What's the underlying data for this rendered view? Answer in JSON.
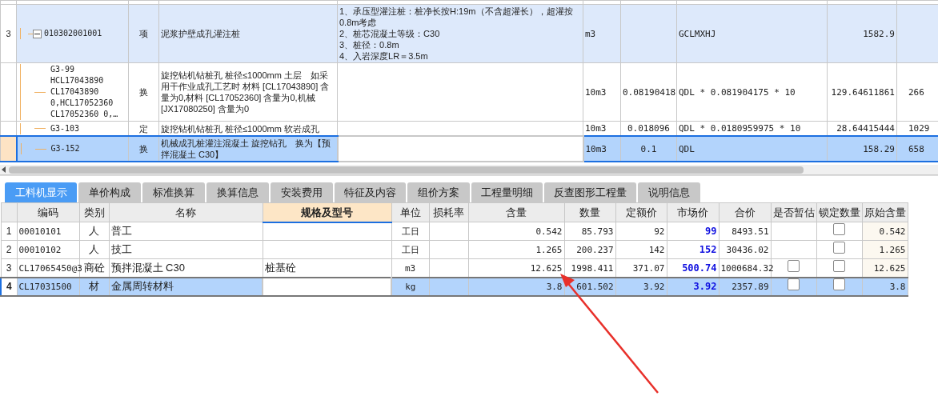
{
  "top_table": {
    "rows": [
      {
        "row_number": "3",
        "kind": "item",
        "expanded": true,
        "selected": false,
        "code": "010302001001",
        "type": "项",
        "name": "泥浆护壁成孔灌注桩",
        "features": [
          "1、承压型灌注桩：桩净长按H:19m（不含超灌长），超灌按0.8m考虑",
          "2、桩芯混凝土等级：C30",
          "3、桩径：0.8m",
          "4、入岩深度LR＝3.5m"
        ],
        "unit": "m3",
        "factor": null,
        "expression": "GCLMXHJ",
        "column_9": "1582.9",
        "column_10": null
      },
      {
        "row_number": null,
        "kind": "sub",
        "selected": false,
        "code": "G3-99\nHCL17043890\nCL17043890\n0,HCL17052360\nCL17052360 0,…",
        "type": "换",
        "name": "旋挖钻机钻桩孔 桩径≤1000mm 土层　如采用干作业成孔工艺时 材料 [CL17043890] 含量为0,材料 [CL17052360] 含量为0,机械 [JX17080250] 含量为0",
        "features": null,
        "unit": "10m3",
        "factor": "0.08190418",
        "expression": "QDL * 0.081904175 * 10",
        "column_9": "129.64611861",
        "column_10": "266"
      },
      {
        "row_number": null,
        "kind": "sub",
        "selected": false,
        "code": "G3-103",
        "type": "定",
        "name": "旋挖钻机钻桩孔 桩径≤1000mm 软岩成孔",
        "features": null,
        "unit": "10m3",
        "factor": "0.018096",
        "expression": "QDL * 0.0180959975 * 10",
        "column_9": "28.64415444",
        "column_10": "1029"
      },
      {
        "row_number": null,
        "kind": "sub",
        "selected": true,
        "code": "G3-152",
        "type": "换",
        "name": "机械成孔桩灌注混凝土 旋挖钻孔　换为【预拌混凝土 C30】",
        "features": null,
        "unit": "10m3",
        "factor": "0.1",
        "expression": "QDL",
        "column_9": "158.29",
        "column_10": "658"
      }
    ]
  },
  "tabs": [
    {
      "label": "工料机显示",
      "selected": true
    },
    {
      "label": "单价构成",
      "selected": false
    },
    {
      "label": "标准换算",
      "selected": false
    },
    {
      "label": "换算信息",
      "selected": false
    },
    {
      "label": "安装费用",
      "selected": false
    },
    {
      "label": "特征及内容",
      "selected": false
    },
    {
      "label": "组价方案",
      "selected": false
    },
    {
      "label": "工程量明细",
      "selected": false
    },
    {
      "label": "反查图形工程量",
      "selected": false
    },
    {
      "label": "说明信息",
      "selected": false
    }
  ],
  "resource_table": {
    "columns": [
      {
        "label": "编码",
        "selected": false
      },
      {
        "label": "类别",
        "selected": false
      },
      {
        "label": "名称",
        "selected": false
      },
      {
        "label": "规格及型号",
        "selected": true
      },
      {
        "label": "单位",
        "selected": false
      },
      {
        "label": "损耗率",
        "selected": false
      },
      {
        "label": "含量",
        "selected": false
      },
      {
        "label": "数量",
        "selected": false
      },
      {
        "label": "定额价",
        "selected": false
      },
      {
        "label": "市场价",
        "selected": false
      },
      {
        "label": "合价",
        "selected": false
      },
      {
        "label": "是否暂估",
        "selected": false
      },
      {
        "label": "锁定数量",
        "selected": false
      },
      {
        "label": "原始含量",
        "selected": false
      }
    ],
    "rows": [
      {
        "row_number": "1",
        "selected": false,
        "cells": [
          "00010101",
          "人",
          "普工",
          null,
          "工日",
          null,
          "0.542",
          "85.793",
          "92",
          "99",
          "8493.51"
        ],
        "lock_quantity": false,
        "original": "0.542"
      },
      {
        "row_number": "2",
        "selected": false,
        "cells": [
          "00010102",
          "人",
          "技工",
          null,
          "工日",
          null,
          "1.265",
          "200.237",
          "142",
          "152",
          "30436.02"
        ],
        "lock_quantity": false,
        "original": "1.265"
      },
      {
        "row_number": "3",
        "selected": false,
        "cells": [
          "CL17065450@3",
          "商砼",
          "预拌混凝土 C30",
          "桩基砼",
          "m3",
          null,
          "12.625",
          "1998.411",
          "371.07",
          "500.74",
          "1000684.32"
        ],
        "provisional": false,
        "lock_quantity": false,
        "original": "12.625"
      },
      {
        "row_number": "4",
        "selected": true,
        "cells": [
          "CL17031500",
          "材",
          "金属周转材料",
          null,
          "kg",
          null,
          "3.8",
          "601.502",
          "3.92",
          "3.92",
          "2357.89"
        ],
        "provisional": false,
        "lock_quantity": false,
        "original": "3.8"
      }
    ]
  }
}
